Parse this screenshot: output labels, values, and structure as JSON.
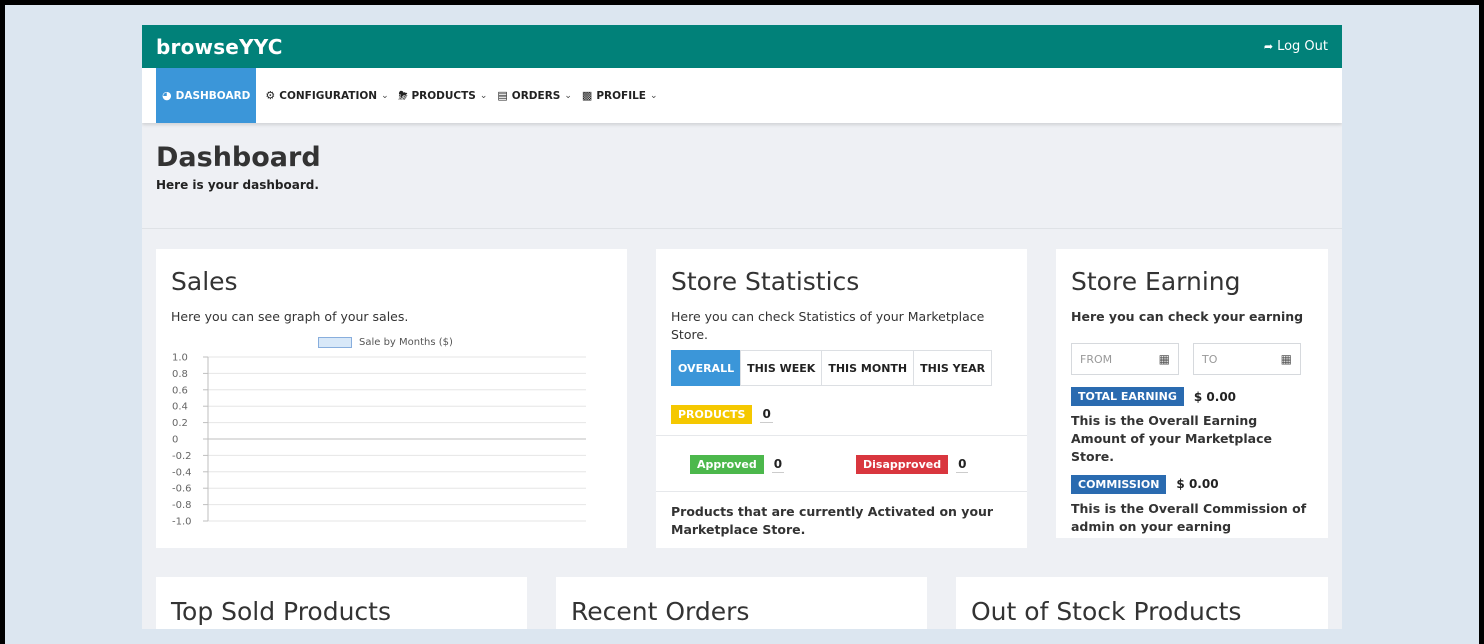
{
  "app": {
    "brand": "browseYYC",
    "logout_label": "Log Out"
  },
  "nav": [
    {
      "label": "DASHBOARD",
      "icon": "dashboard-icon",
      "active": true
    },
    {
      "label": "CONFIGURATION",
      "icon": "gear-icon"
    },
    {
      "label": "PRODUCTS",
      "icon": "tag-icon"
    },
    {
      "label": "ORDERS",
      "icon": "clipboard-icon"
    },
    {
      "label": "PROFILE",
      "icon": "id-card-icon"
    }
  ],
  "page": {
    "title": "Dashboard",
    "subtitle": "Here is your dashboard."
  },
  "sales": {
    "title": "Sales",
    "description": "Here you can see graph of your sales.",
    "chart_data": {
      "type": "line",
      "title": "",
      "series": [
        {
          "name": "Sale by Months ($)",
          "values": []
        }
      ],
      "y_ticks": [
        "1.0",
        "0.8",
        "0.6",
        "0.4",
        "0.2",
        "0",
        "-0.2",
        "-0.4",
        "-0.6",
        "-0.8",
        "-1.0"
      ],
      "ylim": [
        -1.0,
        1.0
      ],
      "legend_position": "top",
      "grid": true
    }
  },
  "stats": {
    "title": "Store Statistics",
    "description": "Here you can check Statistics of your Marketplace Store.",
    "tabs": [
      "OVERALL",
      "THIS WEEK",
      "THIS MONTH",
      "THIS YEAR"
    ],
    "products_label": "PRODUCTS",
    "products_count": "0",
    "approved_label": "Approved",
    "approved_count": "0",
    "disapproved_label": "Disapproved",
    "disapproved_count": "0",
    "footer": "Products that are currently Activated on your Marketplace Store."
  },
  "earning": {
    "title": "Store Earning",
    "description": "Here you can check your earning",
    "from_placeholder": "FROM",
    "to_placeholder": "TO",
    "total_label": "TOTAL EARNING",
    "total_value": "$ 0.00",
    "total_text": "This is the Overall Earning Amount of your Marketplace Store.",
    "commission_label": "COMMISSION",
    "commission_value": "$ 0.00",
    "commission_text": "This is the Overall Commission of admin on your earning"
  },
  "bottom_cards": [
    "Top Sold Products",
    "Recent Orders",
    "Out of Stock Products"
  ],
  "colors": {
    "topbar": "#018179",
    "accent": "#3b96d9",
    "products_badge": "#f5c800",
    "approved": "#4cb84c",
    "disapproved": "#d9363e",
    "earning_badge": "#2a6bb0"
  }
}
